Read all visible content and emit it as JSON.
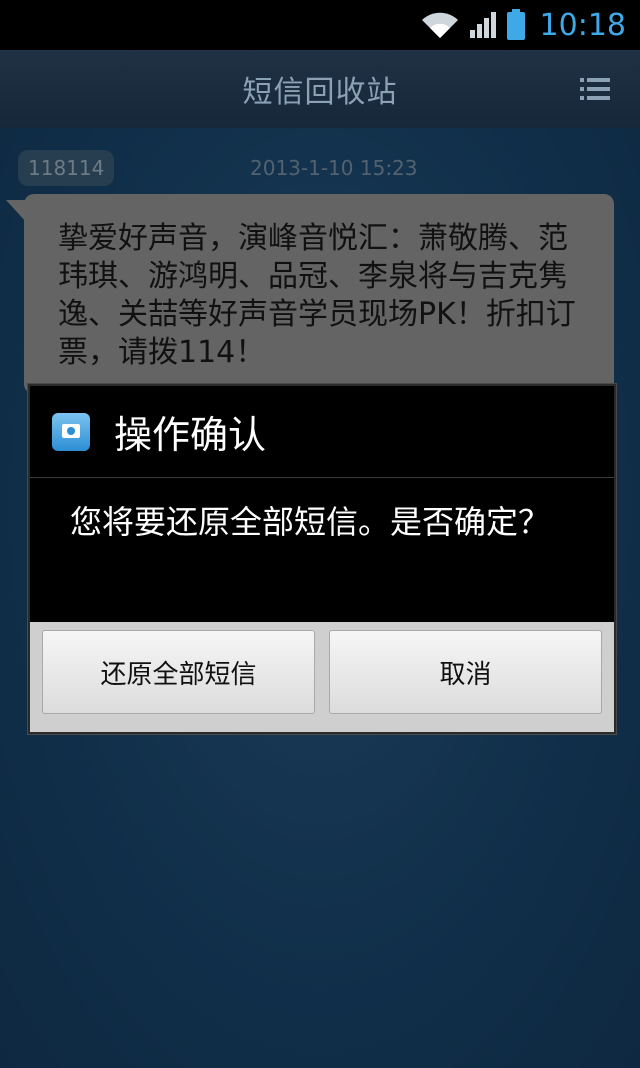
{
  "status_bar": {
    "time": "10:18"
  },
  "app": {
    "title": "短信回收站",
    "menu_icon": "list-menu-icon"
  },
  "message": {
    "sender": "118114",
    "timestamp": "2013-1-10 15:23",
    "body": "挚爱好声音，演峰音悦汇：萧敬腾、范玮琪、游鸿明、品冠、李泉将与吉克隽逸、关喆等好声音学员现场PK！折扣订票，请拨114！"
  },
  "dialog": {
    "title": "操作确认",
    "message": "您将要还原全部短信。是否确定？",
    "confirm_label": "还原全部短信",
    "cancel_label": "取消",
    "icon": "app-icon"
  },
  "colors": {
    "clock": "#3fa9e8",
    "background": "#1c4b73",
    "dialog_bg": "#000000",
    "bubble": "#9a9a9a"
  }
}
